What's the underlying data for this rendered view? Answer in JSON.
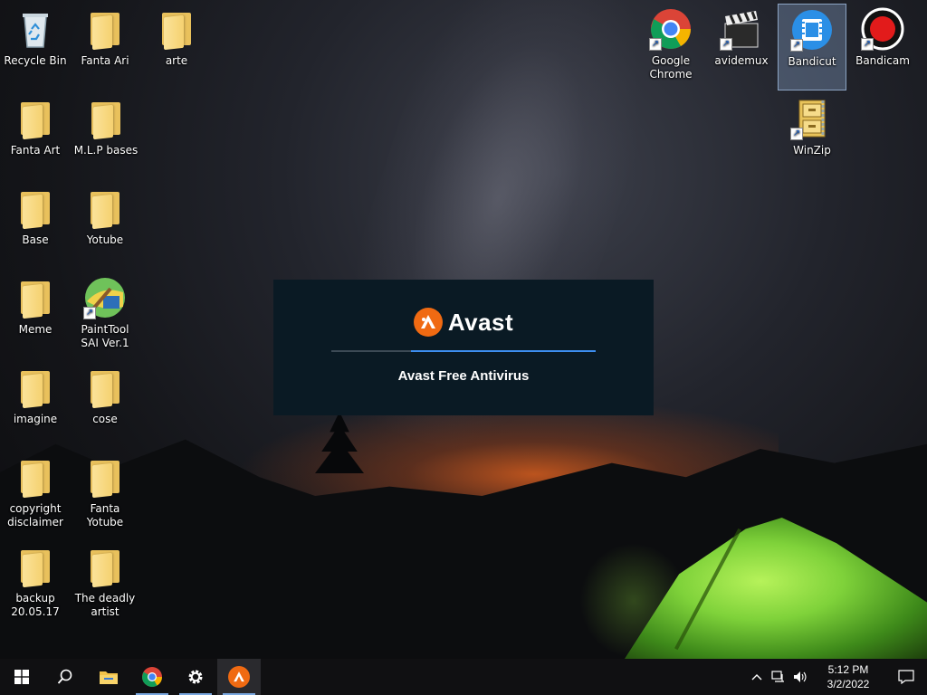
{
  "desktop": {
    "icons": [
      {
        "label": "Recycle Bin",
        "type": "recycle-bin"
      },
      {
        "label": "Fanta Ari",
        "type": "folder"
      },
      {
        "label": "arte",
        "type": "folder"
      },
      {
        "label": "Fanta Art",
        "type": "folder"
      },
      {
        "label": "M.L.P bases",
        "type": "folder"
      },
      {
        "label": "Base",
        "type": "folder"
      },
      {
        "label": "Yotube",
        "type": "folder"
      },
      {
        "label": "Meme",
        "type": "folder"
      },
      {
        "label": "PaintTool SAI Ver.1",
        "type": "app"
      },
      {
        "label": "imagine",
        "type": "folder"
      },
      {
        "label": "cose",
        "type": "folder"
      },
      {
        "label": "copyright disclaimer",
        "type": "folder"
      },
      {
        "label": "Fanta Yotube",
        "type": "folder"
      },
      {
        "label": "backup 20.05.17",
        "type": "folder"
      },
      {
        "label": "The deadly artist",
        "type": "folder"
      },
      {
        "label": "Google Chrome",
        "type": "app"
      },
      {
        "label": "avidemux",
        "type": "app"
      },
      {
        "label": "Bandicut",
        "type": "app",
        "selected": true
      },
      {
        "label": "Bandicam",
        "type": "app"
      },
      {
        "label": "WinZip",
        "type": "app"
      }
    ]
  },
  "splash": {
    "brand": "Avast",
    "product": "Avast Free Antivirus",
    "progress": 0.7,
    "accent": "#f06a12",
    "progress_color": "#3d8ef0"
  },
  "taskbar": {
    "buttons": [
      "start-icon",
      "search-icon",
      "file-explorer-icon",
      "chrome-icon",
      "settings-icon",
      "avast-icon"
    ],
    "active": "avast-icon",
    "clock": {
      "time": "5:12 PM",
      "date": "3/2/2022"
    }
  }
}
